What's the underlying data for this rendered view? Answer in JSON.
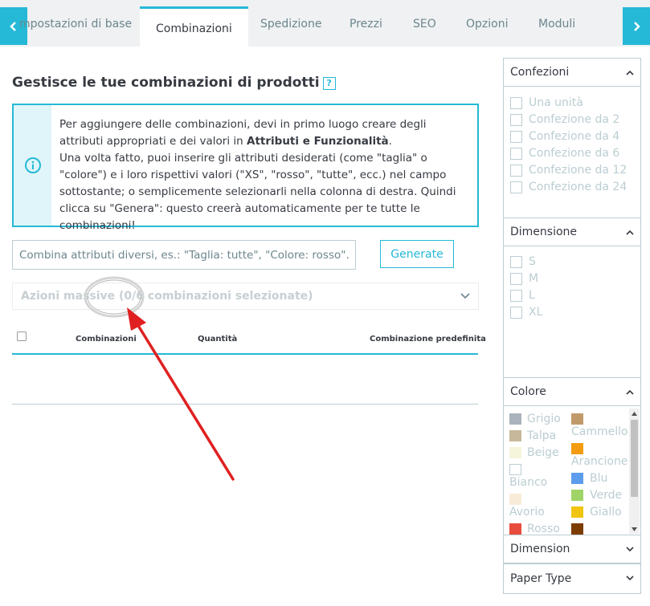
{
  "tabs": [
    {
      "label": "mpostazioni di base"
    },
    {
      "label": "Combinazioni"
    },
    {
      "label": "Spedizione"
    },
    {
      "label": "Prezzi"
    },
    {
      "label": "SEO"
    },
    {
      "label": "Opzioni"
    },
    {
      "label": "Moduli"
    }
  ],
  "main": {
    "title": "Gestisce le tue combinazioni di prodotti",
    "help_label": "?",
    "info": {
      "part1": "Per aggiungere delle combinazioni, devi in primo luogo creare degli attributi appropriati e dei valori in ",
      "bold": "Attributi e Funzionalità",
      "part2": ".",
      "part3": "Una volta fatto, puoi inserire gli attributi desiderati (come \"taglia\" o \"colore\") e i loro rispettivi valori (\"XS\", \"rosso\", \"tutte\", ecc.) nel campo sottostante; o semplicemente selezionarli nella colonna di destra. Quindi clicca su \"Genera\": questo creerà automaticamente per te tutte le combinazioni!"
    },
    "input_placeholder": "Combina attributi diversi, es.: \"Taglia: tutte\", \"Colore: rosso\".",
    "generate_label": "Generate",
    "bulk_label": "Azioni massive (0/6 combinazioni selezionate)",
    "columns": {
      "combinations": "Combinazioni",
      "quantity": "Quantità",
      "default": "Combinazione predefinita"
    }
  },
  "filters": {
    "confezioni": {
      "title": "Confezioni",
      "options": [
        "Una unità",
        "Confezione da 2",
        "Confezione da 4",
        "Confezione da 6",
        "Confezione da 12",
        "Confezione da 24"
      ]
    },
    "dimensione": {
      "title": "Dimensione",
      "options": [
        "S",
        "M",
        "L",
        "XL"
      ]
    },
    "colore": {
      "title": "Colore",
      "colors": [
        {
          "name": "Grigio",
          "hex": "#aab2bd"
        },
        {
          "name": "Talpa",
          "hex": "#c7b89b"
        },
        {
          "name": "Beige",
          "hex": "#f5f5dc"
        },
        {
          "name": "Bianco",
          "hex": "#ffffff"
        },
        {
          "name": "Avorio",
          "hex": "#f8ecd8"
        },
        {
          "name": "Rosso",
          "hex": "#e84c3d"
        },
        {
          "name": "Cammello",
          "hex": "#c19a6b"
        },
        {
          "name": "Arancione",
          "hex": "#f39c11"
        },
        {
          "name": "Blu",
          "hex": "#5d9cec"
        },
        {
          "name": "Verde",
          "hex": "#a0d468"
        },
        {
          "name": "Giallo",
          "hex": "#f1c40f"
        },
        {
          "name": "",
          "hex": "#7d3c00"
        }
      ]
    },
    "dimension": {
      "title": "Dimension"
    },
    "paper_type": {
      "title": "Paper Type"
    }
  },
  "colors": {
    "accent": "#25b9d7",
    "annotation": "#e02020",
    "muted": "#bbcdd2"
  }
}
